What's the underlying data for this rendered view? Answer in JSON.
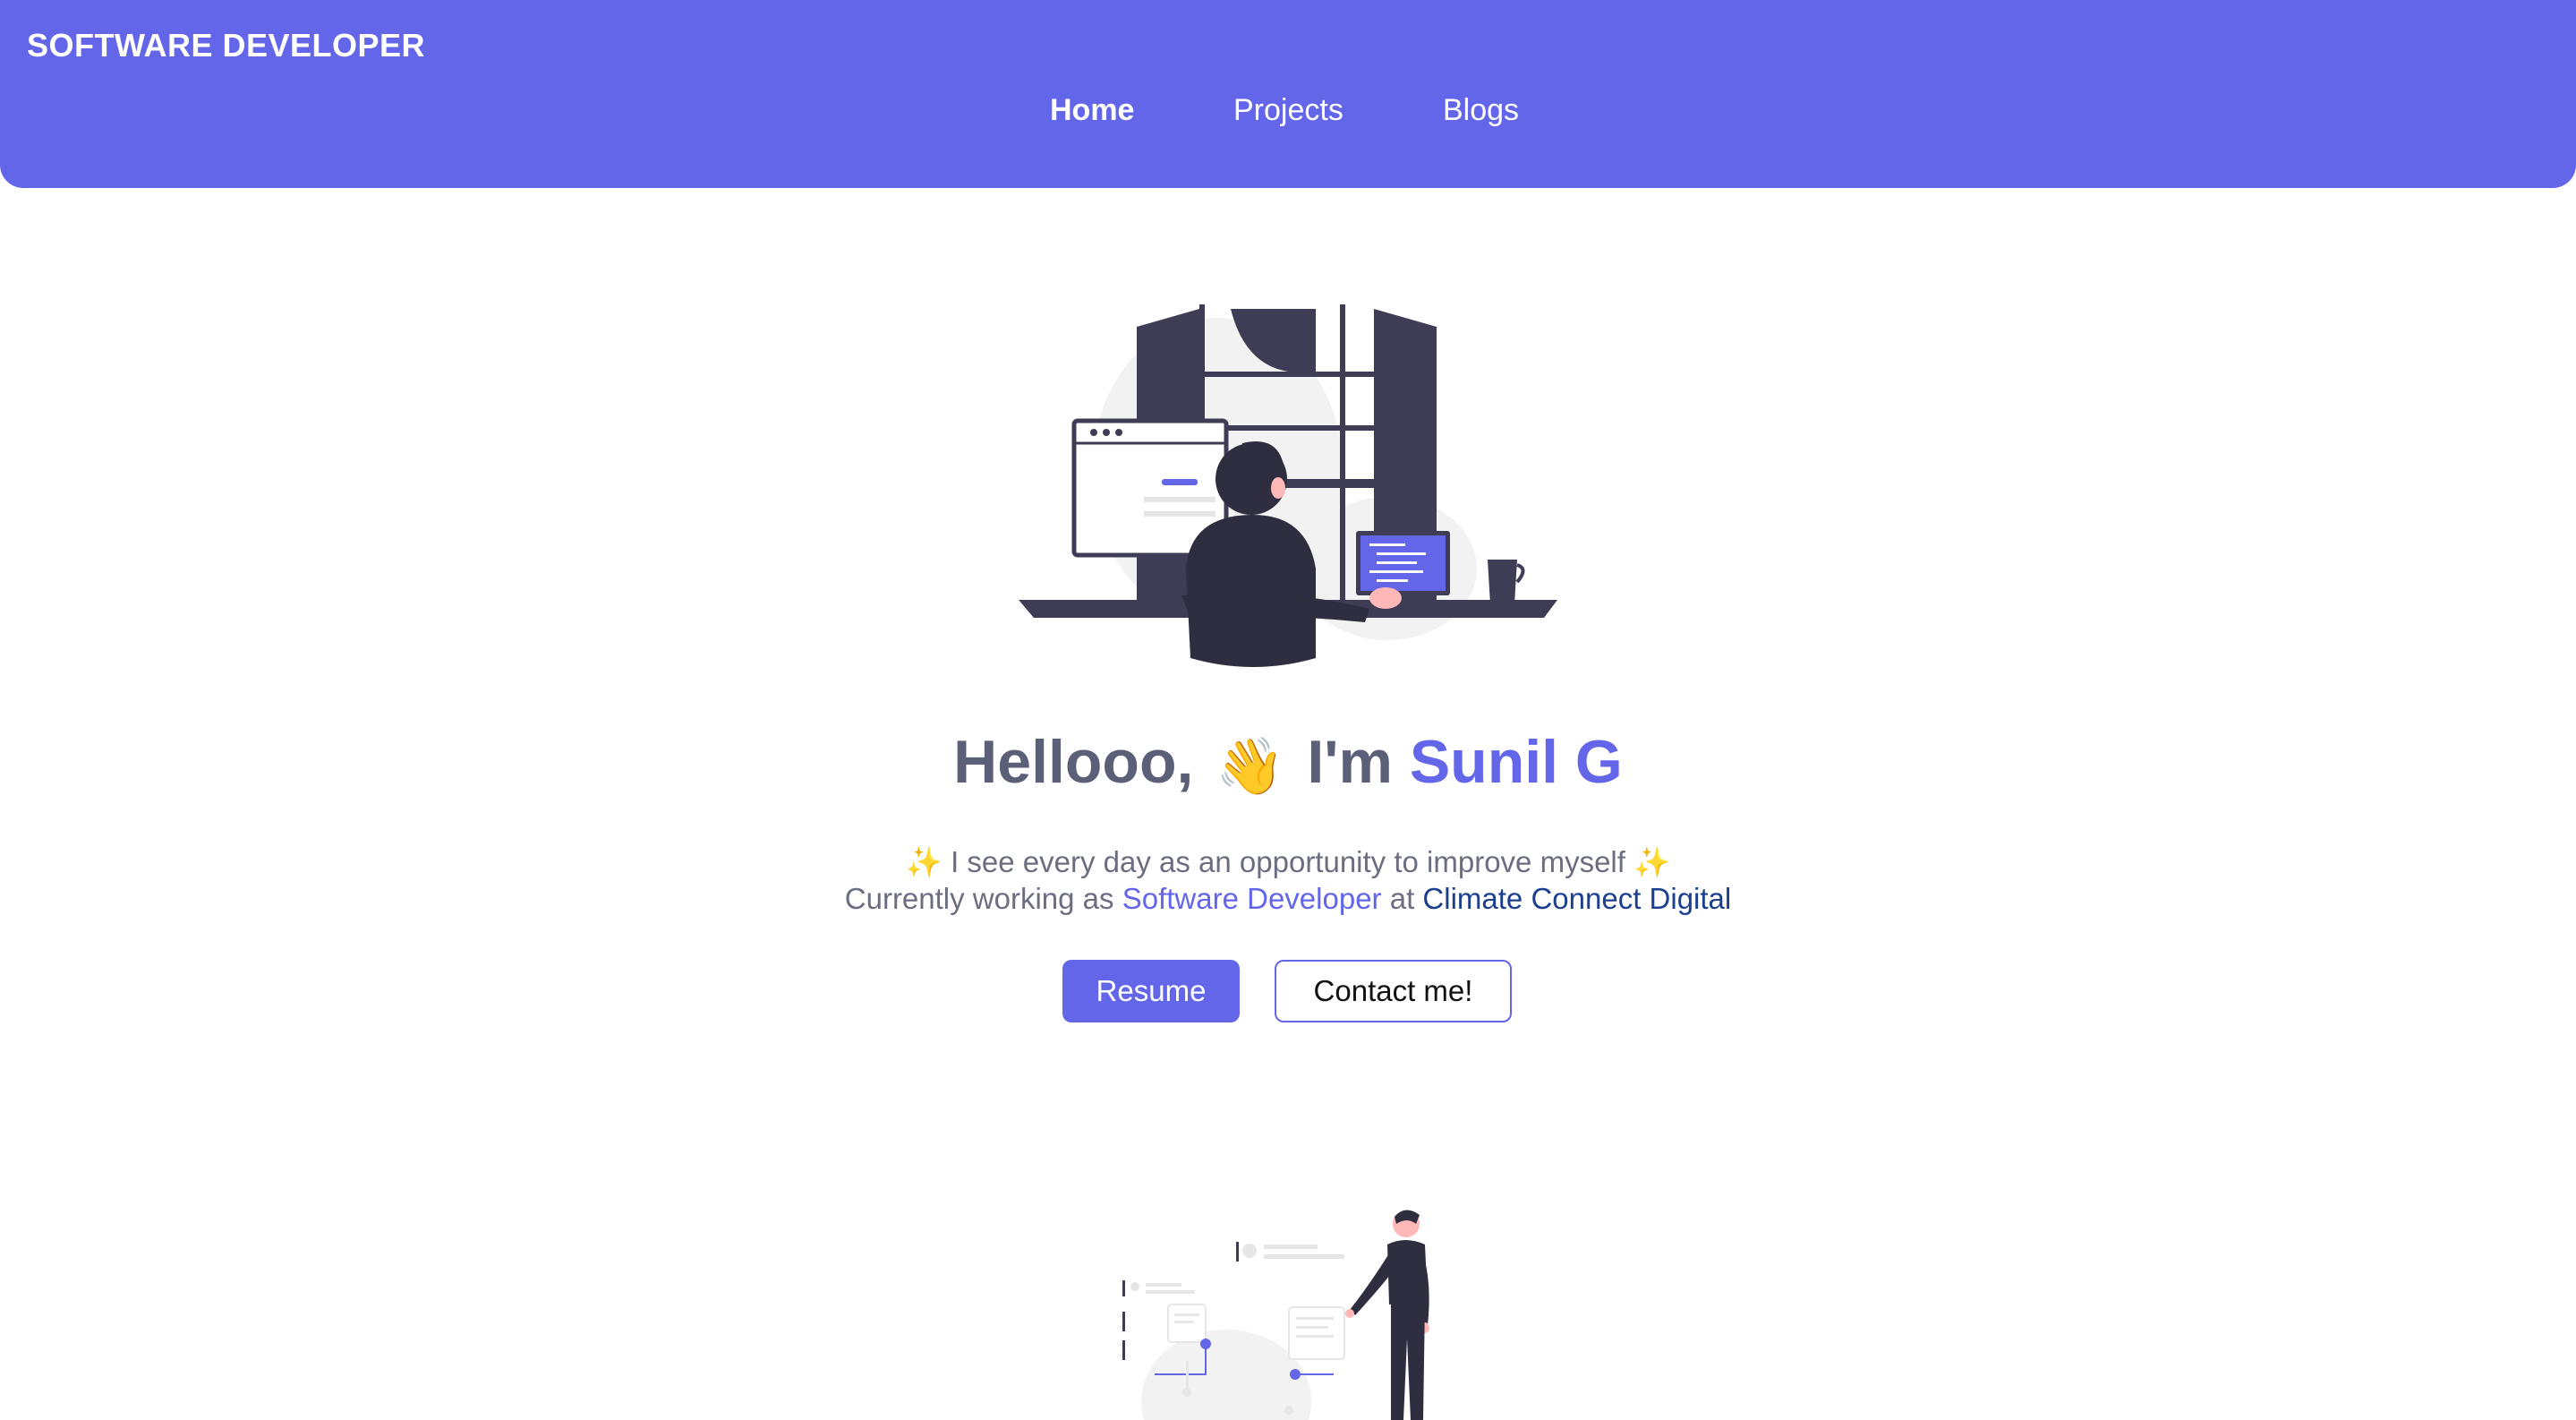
{
  "header": {
    "brand": "SOFTWARE DEVELOPER",
    "nav": [
      {
        "label": "Home",
        "active": true
      },
      {
        "label": "Projects",
        "active": false
      },
      {
        "label": "Blogs",
        "active": false
      }
    ]
  },
  "hero": {
    "greeting_prefix": "Hellooo,",
    "wave_emoji": "👋",
    "greeting_mid": "I'm",
    "name": "Sunil G",
    "sparkle": "✨",
    "tagline": "I see every day as an opportunity to improve myself",
    "work_prefix": "Currently working as",
    "role": "Software Developer",
    "work_at": "at",
    "company": "Climate Connect Digital"
  },
  "buttons": {
    "resume": "Resume",
    "contact": "Contact me!"
  },
  "colors": {
    "accent": "#6366e9",
    "heading": "#5b5f78",
    "body_text": "#6b6e80",
    "company_link": "#1c3f8f",
    "illustration_dark": "#3f3d56",
    "illustration_light": "#f2f2f2"
  },
  "icons": {
    "hero": "developer-at-desk-illustration",
    "bottom": "person-with-flowchart-illustration"
  }
}
